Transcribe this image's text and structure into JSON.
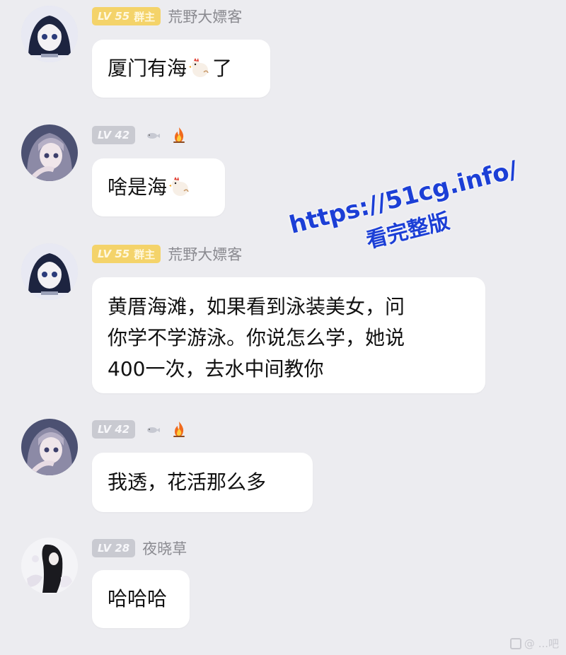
{
  "messages": [
    {
      "level": "LV 55",
      "role": "群主",
      "nickname": "荒野大嫖客",
      "text_before": "厦门有海",
      "text_after": "了",
      "emoji": "chicken-emoji"
    },
    {
      "level": "LV 42",
      "badges": [
        "fish-icon",
        "fire-icon"
      ],
      "text_before": "啥是海",
      "emoji": "chicken-emoji"
    },
    {
      "level": "LV 55",
      "role": "群主",
      "nickname": "荒野大嫖客",
      "lines": [
        "黄厝海滩，如果看到泳装美女，问",
        "你学不学游泳。你说怎么学，她说",
        "400一次，去水中间教你"
      ]
    },
    {
      "level": "LV 42",
      "badges": [
        "fish-icon",
        "fire-icon"
      ],
      "text": "我透，花活那么多"
    },
    {
      "level": "LV 28",
      "nickname": "夜晓草",
      "text": "哈哈哈"
    }
  ],
  "watermark": {
    "url": "https://51cg.info/",
    "subtitle": "看完整版"
  },
  "corner_mark": "@ ...吧",
  "colors": {
    "background": "#ececf0",
    "bubble": "#ffffff",
    "level_gold": "#f4d36a",
    "level_grey": "#c9cad1",
    "watermark": "#1c3fd6"
  }
}
